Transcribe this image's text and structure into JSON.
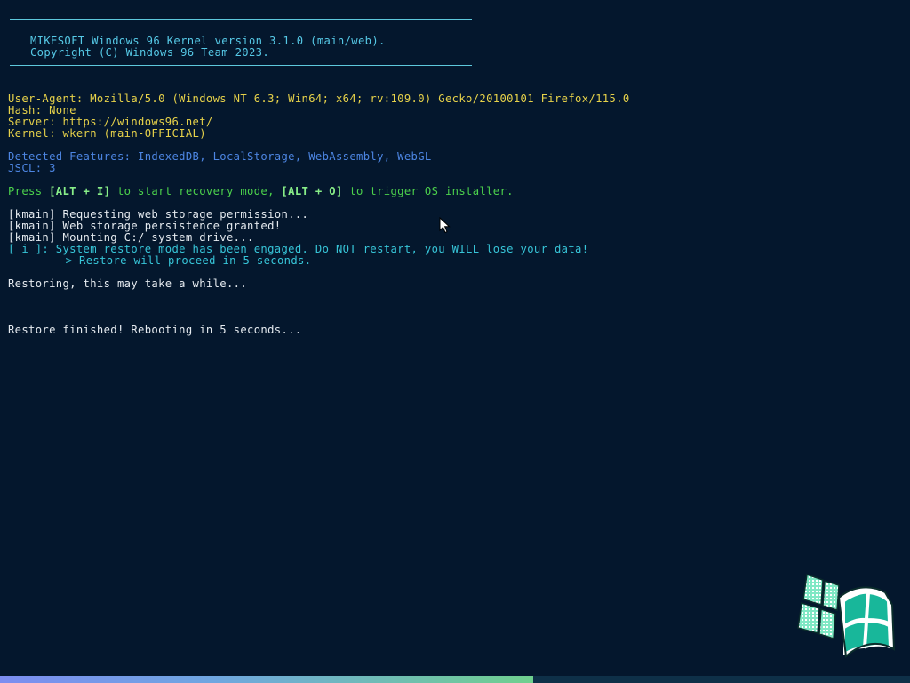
{
  "banner": {
    "title_line": "MIKESOFT Windows 96 Kernel version 3.1.0 (main/web).",
    "copyright_line": "Copyright (C) Windows 96 Team 2023."
  },
  "env": {
    "user_agent": "User-Agent: Mozilla/5.0 (Windows NT 6.3; Win64; x64; rv:109.0) Gecko/20100101 Firefox/115.0",
    "hash": "Hash: None",
    "server": "Server: https://windows96.net/",
    "kernel": "Kernel: wkern (main-OFFICIAL)"
  },
  "features": {
    "detected": "Detected Features: IndexedDB, LocalStorage, WebAssembly, WebGL",
    "jscl": "JSCL: 3"
  },
  "prompt": {
    "press": "Press ",
    "key_recovery": "[ALT + I]",
    "mid": " to start recovery mode, ",
    "key_installer": "[ALT + O]",
    "end": " to trigger OS installer."
  },
  "log": [
    "[kmain] Requesting web storage permission...",
    "[kmain] Web storage persistence granted!",
    "[kmain] Mounting C:/ system drive..."
  ],
  "info": {
    "warning": "[ i ]: System restore mode has been engaged. Do NOT restart, you WILL lose your data!",
    "proceed": "-> Restore will proceed in 5 seconds."
  },
  "status": {
    "restoring": "Restoring, this may take a while...",
    "finished": "Restore finished! Rebooting in 5 seconds..."
  },
  "icons": {
    "cursor": "mouse-pointer-icon",
    "logo": "windows96-logo-icon"
  },
  "progress": {
    "fraction": 0.586
  },
  "colors": {
    "background": "#04172d",
    "banner": "#56c9e6",
    "env": "#e7d24a",
    "features": "#4d86e3",
    "prompt": "#4cd24c",
    "info": "#37c5d8"
  }
}
